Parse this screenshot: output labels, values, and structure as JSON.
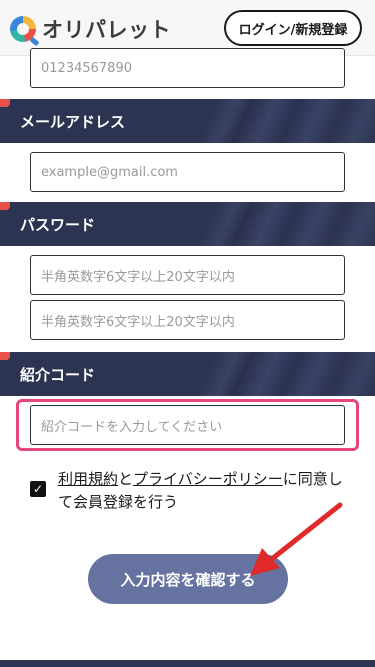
{
  "header": {
    "logo_text": "オリパレット",
    "login_button": "ログイン/新規登録"
  },
  "phone": {
    "value": "01234567890"
  },
  "email_section": {
    "title": "メールアドレス",
    "placeholder": "example@gmail.com"
  },
  "password_section": {
    "title": "パスワード",
    "password_placeholder": "半角英数字6文字以上20文字以内",
    "confirm_placeholder": "半角英数字6文字以上20文字以内"
  },
  "referral_section": {
    "title": "紹介コード",
    "placeholder": "紹介コードを入力してください"
  },
  "agreement": {
    "checked": true,
    "terms_link": "利用規約",
    "connector": "と",
    "privacy_link": "プライバシーポリシー",
    "suffix": "に同意して会員登録を行う"
  },
  "confirm_button": "入力内容を確認する",
  "colors": {
    "section_bar": "#2d3452",
    "accent_red": "#e8524a",
    "highlight_pink": "#e5477a",
    "button": "#6673a0"
  }
}
